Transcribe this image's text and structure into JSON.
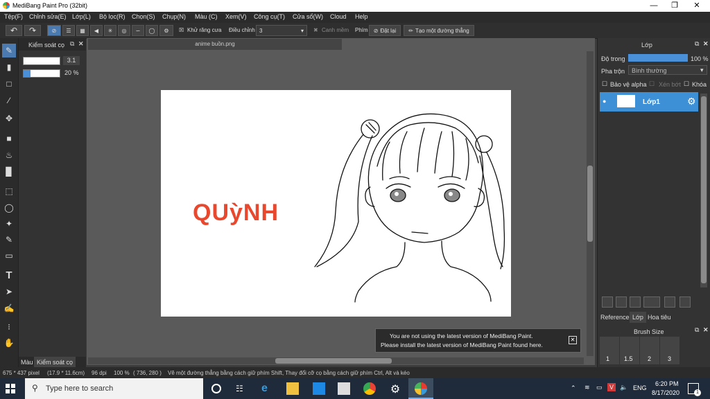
{
  "window": {
    "title": "MediBang Paint Pro (32bit)"
  },
  "menu": [
    "Tệp(F)",
    "Chỉnh sửa(E)",
    "Lớp(L)",
    "Bộ lọc(R)",
    "Chọn(S)",
    "Chụp(N)",
    "Màu (C)",
    "Xem(V)",
    "Công cụ(T)",
    "Cửa sổ(W)",
    "Cloud",
    "Help"
  ],
  "toolbar": {
    "antialias_label": "Khử răng cưa",
    "adjust_label": "Điều chỉnh",
    "adjust_value": "3",
    "smooth_label": "Canh mềm",
    "key_label": "Phím",
    "reset_label": "Đặt lại",
    "straight_line_label": "Tạo một đường thẳng"
  },
  "brush_panel": {
    "title": "Kiểm soát cọ",
    "size_value": "3.1",
    "size_fraction": 0.2,
    "opacity_value": "20 %",
    "opacity_fraction": 0.2,
    "tab_color": "Màu",
    "tab_brush": "Kiểm soát cọ"
  },
  "document": {
    "tab_title": "anime buồn.png",
    "canvas_text": "QUỳNH",
    "canvas_text_color": "#e8482e"
  },
  "layer_panel": {
    "title": "Lớp",
    "opacity_label": "Độ trong",
    "opacity_value": "100 %",
    "opacity_fraction": 1.0,
    "blend_label": "Pha trộn",
    "blend_value": "Bình thường",
    "protect_alpha": "Bảo vệ alpha",
    "clip": "Xén bớt",
    "lock": "Khóa",
    "layer_name": "Lớp1",
    "tabs": [
      "Reference",
      "Lớp",
      "Hoa tiêu"
    ]
  },
  "brush_size": {
    "title": "Brush Size",
    "sizes": [
      "1",
      "1.5",
      "2",
      "3"
    ]
  },
  "notification": {
    "line1": "You are not using the latest version of MediBang Paint.",
    "line2": "Please install the latest version of MediBang Paint found here."
  },
  "status": {
    "dims": "675 * 437 pixel",
    "physical": "(17.9 * 11.6cm)",
    "dpi": "96 dpi",
    "zoom": "100 %",
    "cursor": "( 736, 280 )",
    "hint": "Vẽ một đường thẳng bằng cách giữ phím Shift, Thay đổi cỡ cọ bằng cách giữ phím Ctrl, Alt và kéo"
  },
  "taskbar": {
    "search_placeholder": "Type here to search",
    "lang": "ENG",
    "time": "6:20 PM",
    "date": "8/17/2020",
    "notif_count": "1"
  },
  "colors": {
    "accent": "#4a90d9",
    "layer_selected": "#3d8fd6"
  }
}
